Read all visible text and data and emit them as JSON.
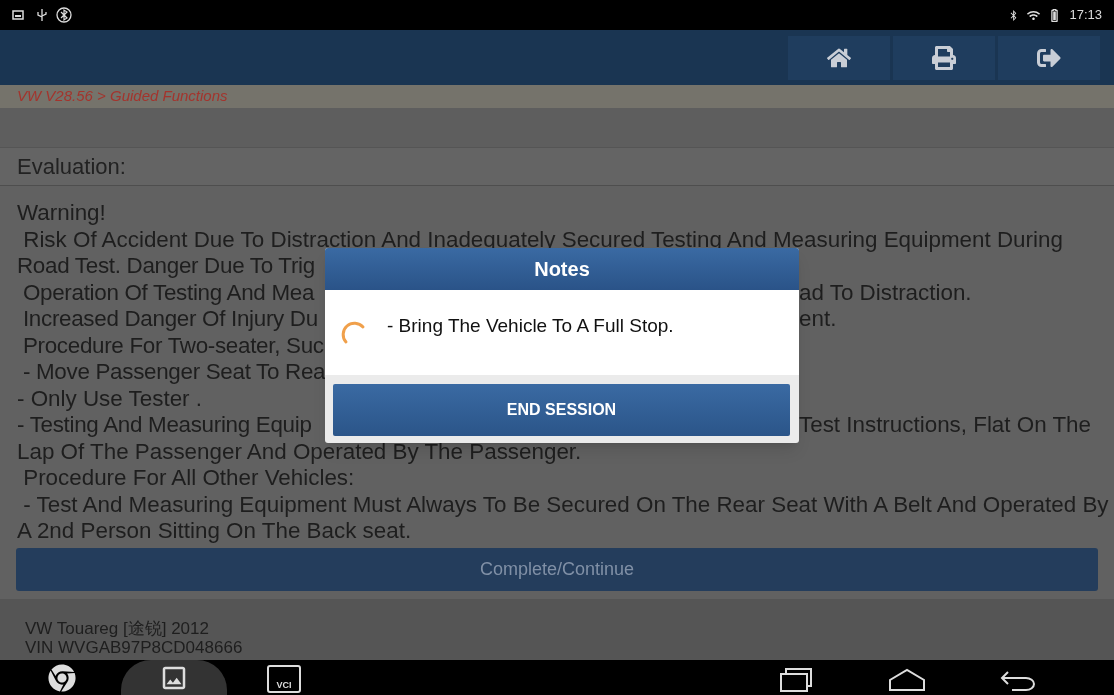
{
  "status_bar": {
    "time": "17:13"
  },
  "breadcrumb": "VW V28.56 > Guided Functions",
  "section_title": "Evaluation:",
  "lines": [
    {
      "kind": "full",
      "text": "Warning!"
    },
    {
      "kind": "full",
      "text": " Risk Of Accident Due To Distraction And Inadequately Secured Testing And Measuring Equipment During"
    },
    {
      "kind": "split",
      "left": "Road Test. Danger Due To Trig"
    },
    {
      "kind": "split",
      "left": " Operation Of Testing And Mea",
      "right": "ad To Distraction."
    },
    {
      "kind": "split",
      "left": " Increased Danger Of Injury Du",
      "right": "ent."
    },
    {
      "kind": "split",
      "left": " Procedure For Two-seater, Suc"
    },
    {
      "kind": "split",
      "left": " - Move Passenger Seat To Rea"
    },
    {
      "kind": "full",
      "text": "- Only Use Tester ."
    },
    {
      "kind": "split",
      "left": "- Testing And Measuring Equip",
      "right": "Test Instructions, Flat On The"
    },
    {
      "kind": "full",
      "text": "Lap Of The Passenger And Operated By The Passenger."
    },
    {
      "kind": "full",
      "text": " Procedure For All Other Vehicles:"
    },
    {
      "kind": "full",
      "text": " - Test And Measuring Equipment Must Always To Be Secured On The Rear Seat With A Belt And Operated By"
    },
    {
      "kind": "full",
      "text": "A 2nd Person Sitting On The Back seat."
    }
  ],
  "continue_button": {
    "label": "Complete/Continue",
    "disabled": true
  },
  "vehicle": [
    "VW Touareg [途锐] 2012",
    "VIN WVGAB97P8CD048666"
  ],
  "nav_bar": {
    "vci_label": "VCI"
  },
  "dialog": {
    "title": "Notes",
    "message": "- Bring The Vehicle To A Full Stop.",
    "button": "END SESSION"
  }
}
